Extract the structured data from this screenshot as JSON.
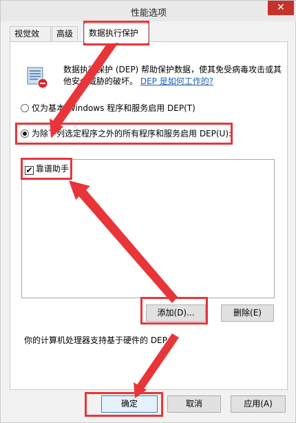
{
  "window": {
    "title": "性能选项",
    "close_glyph": "✕"
  },
  "tabs": [
    {
      "label": "视觉效果",
      "active": false
    },
    {
      "label": "高级",
      "active": false
    },
    {
      "label": "数据执行保护",
      "active": true
    }
  ],
  "dep": {
    "description": "数据执行保护 (DEP) 帮助保护数据，使其免受病毒攻击或其他安全威胁的破坏。",
    "help_link": "DEP 是如何工作的?",
    "options": [
      {
        "label": "仅为基本 Windows 程序和服务启用 DEP(T)",
        "selected": false
      },
      {
        "label": "为除下列选定程序之外的所有程序和服务启用 DEP(U):",
        "selected": true
      }
    ],
    "exception_list": [
      {
        "label": "靠谱助手",
        "checked": true,
        "check_glyph": "✔"
      }
    ],
    "add_label": "添加(D)...",
    "remove_label": "删除(E)",
    "hardware_note": "你的计算机处理器支持基于硬件的 DEP。"
  },
  "footer": {
    "ok_label": "确定",
    "cancel_label": "取消",
    "apply_label": "应用(A)"
  },
  "annotation_color": "#e8353a"
}
